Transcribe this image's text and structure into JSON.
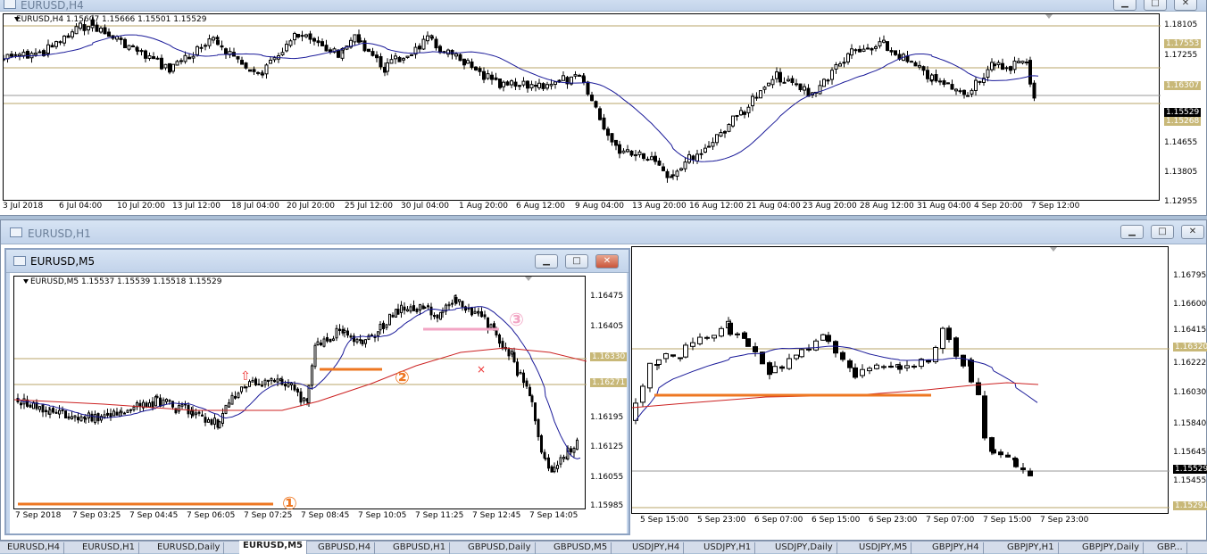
{
  "colors": {
    "ma_blue": "#1a1a99",
    "ma_red": "#cc2222",
    "level": "#b9a66a",
    "orange": "#ee7722",
    "pink": "#f2a5c4",
    "price_tag": "#e6d9a8"
  },
  "win_h4": {
    "title": "EURUSD,H4",
    "info": "EURUSD,H4  1.15607 1.15666 1.15501 1.15529",
    "prices": [
      "1.18105",
      "1.17553",
      "1.17255",
      "1.16307",
      "1.15529",
      "1.15268",
      "1.14655",
      "1.13805",
      "1.12955"
    ],
    "times": [
      "3 Jul 2018",
      "6 Jul 04:00",
      "10 Jul 20:00",
      "13 Jul 12:00",
      "18 Jul 04:00",
      "20 Jul 20:00",
      "25 Jul 12:00",
      "30 Jul 04:00",
      "1 Aug 20:00",
      "6 Aug 12:00",
      "9 Aug 04:00",
      "13 Aug 20:00",
      "16 Aug 12:00",
      "21 Aug 04:00",
      "23 Aug 20:00",
      "28 Aug 12:00",
      "31 Aug 04:00",
      "4 Sep 20:00",
      "7 Sep 12:00"
    ]
  },
  "win_h1": {
    "title": "EURUSD,H1",
    "prices": [
      "1.16795",
      "1.16600",
      "1.16415",
      "1.16320",
      "1.16222",
      "1.16030",
      "1.15840",
      "1.15645",
      "1.15529",
      "1.15455",
      "1.15291"
    ],
    "times": [
      "5 Sep 15:00",
      "5 Sep 23:00",
      "6 Sep 07:00",
      "6 Sep 15:00",
      "6 Sep 23:00",
      "7 Sep 07:00",
      "7 Sep 15:00",
      "7 Sep 23:00"
    ]
  },
  "win_m5": {
    "title": "EURUSD,M5",
    "info": "EURUSD,M5  1.15537 1.15539 1.15518 1.15529",
    "prices": [
      "1.16475",
      "1.16405",
      "1.16330",
      "1.16271",
      "1.16195",
      "1.16125",
      "1.16055",
      "1.15985"
    ],
    "times": [
      "7 Sep 2018",
      "7 Sep 03:25",
      "7 Sep 04:45",
      "7 Sep 06:05",
      "7 Sep 07:25",
      "7 Sep 08:45",
      "7 Sep 10:05",
      "7 Sep 11:25",
      "7 Sep 12:45",
      "7 Sep 14:05"
    ],
    "annotations": [
      "①",
      "②",
      "③"
    ]
  },
  "tabs": [
    "EURUSD,H4",
    "EURUSD,H1",
    "EURUSD,Daily",
    "EURUSD,M5",
    "GBPUSD,H4",
    "GBPUSD,H1",
    "GBPUSD,Daily",
    "GBPUSD,M5",
    "USDJPY,H4",
    "USDJPY,H1",
    "USDJPY,Daily",
    "USDJPY,M5",
    "GBPJPY,H4",
    "GBPJPY,H1",
    "GBPJPY,Daily",
    "GBP..."
  ],
  "active_tab": "EURUSD,M5"
}
